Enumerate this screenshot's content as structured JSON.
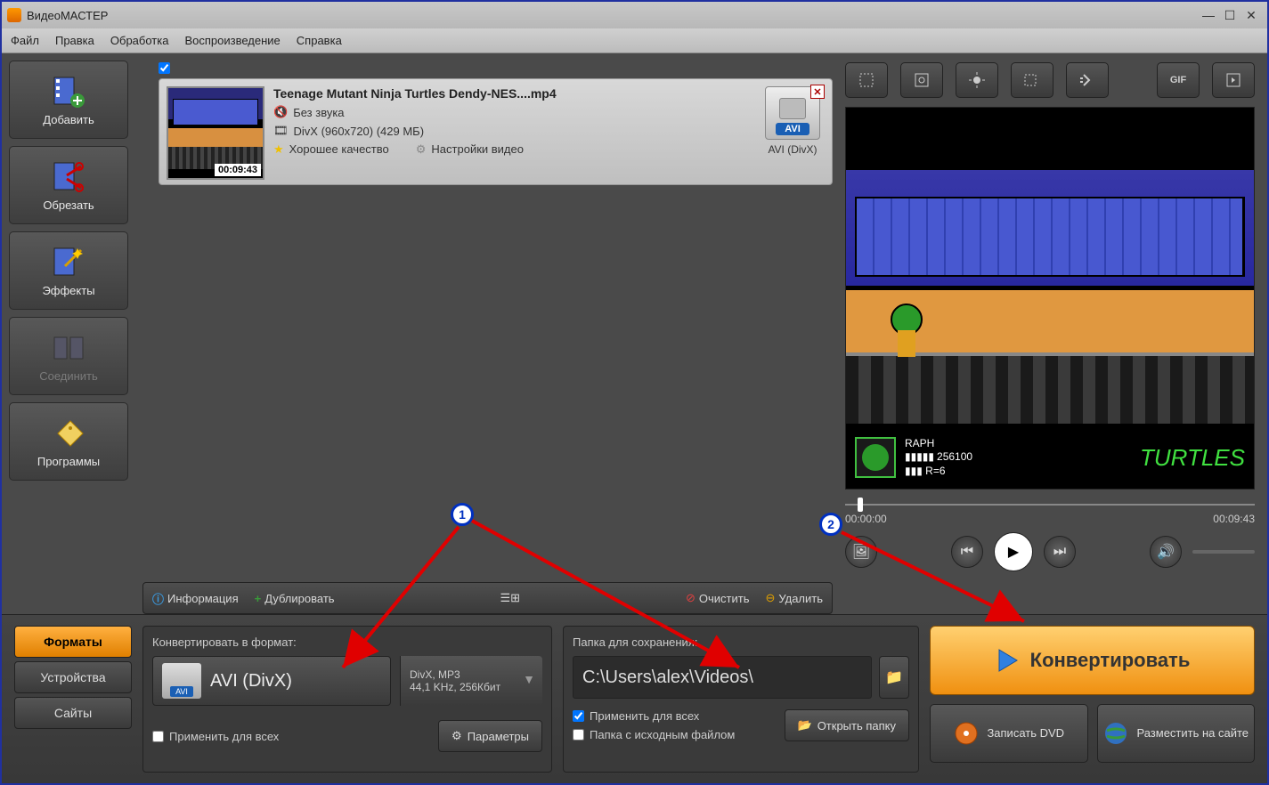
{
  "title": "ВидеоМАСТЕР",
  "menu": {
    "file": "Файл",
    "edit": "Правка",
    "process": "Обработка",
    "playback": "Воспроизведение",
    "help": "Справка"
  },
  "sidebar": {
    "add": "Добавить",
    "cut": "Обрезать",
    "effects": "Эффекты",
    "join": "Соединить",
    "programs": "Программы"
  },
  "file": {
    "title": "Teenage Mutant Ninja Turtles Dendy-NES....mp4",
    "audio": "Без звука",
    "video": "DivX (960x720) (429 МБ)",
    "quality": "Хорошее качество",
    "settings": "Настройки видео",
    "format_badge": "AVI",
    "format_text": "AVI (DivX)",
    "duration": "00:09:43"
  },
  "toolbar": {
    "info": "Информация",
    "duplicate": "Дублировать",
    "clear": "Очистить",
    "delete": "Удалить"
  },
  "preview": {
    "time_start": "00:00:00",
    "time_end": "00:09:43",
    "hud_name": "RAPH",
    "hud_score": "256100",
    "hud_r": "R=6",
    "hud_logo": "TURTLES"
  },
  "tools": {
    "gif": "GIF"
  },
  "bottom": {
    "tabs": {
      "formats": "Форматы",
      "devices": "Устройства",
      "sites": "Сайты"
    },
    "convert_label": "Конвертировать в формат:",
    "format_avi": "AVI",
    "format_name": "AVI (DivX)",
    "format_meta1": "DivX, MP3",
    "format_meta2": "44,1 KHz, 256Кбит",
    "apply_all": "Применить для всех",
    "params": "Параметры",
    "folder_label": "Папка для сохранения:",
    "path": "C:\\Users\\alex\\Videos\\",
    "apply_all2": "Применить для всех",
    "source_folder": "Папка с исходным файлом",
    "open_folder": "Открыть папку",
    "convert": "Конвертировать",
    "dvd": "Записать DVD",
    "upload": "Разместить на сайте"
  },
  "markers": {
    "one": "1",
    "two": "2"
  }
}
